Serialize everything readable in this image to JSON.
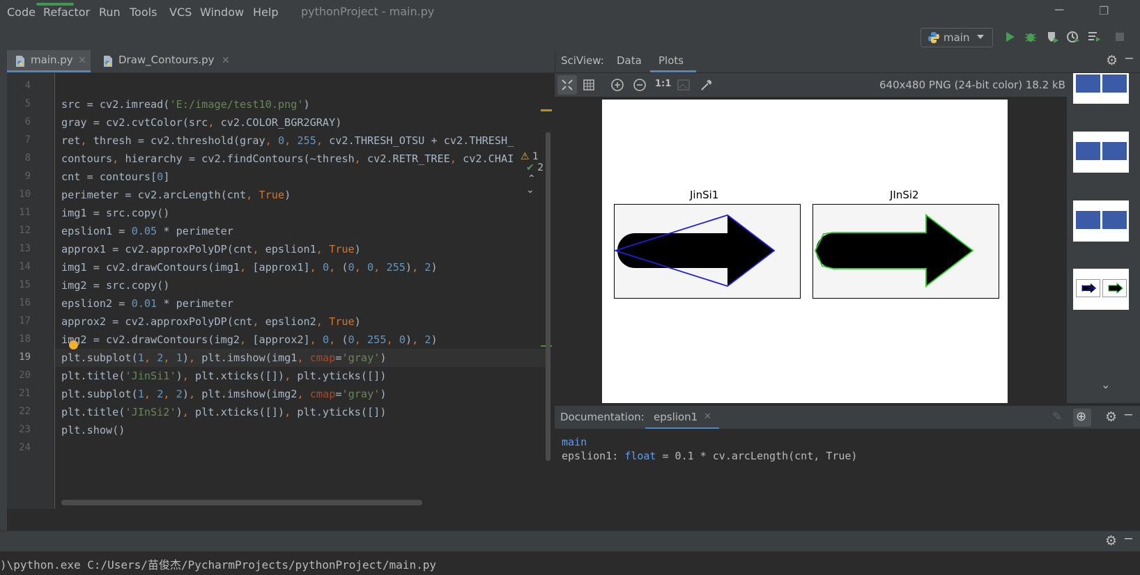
{
  "menu": {
    "items": [
      "Code",
      "Refactor",
      "Run",
      "Tools",
      "VCS",
      "Window",
      "Help"
    ],
    "window_title": "pythonProject - main.py"
  },
  "toolbar": {
    "run_config": "main",
    "icons": [
      "python-icon",
      "run-icon",
      "debug-icon",
      "coverage-icon",
      "profile-icon",
      "run-menu-icon",
      "stop-icon"
    ]
  },
  "editor": {
    "tabs": [
      {
        "label": "main.py",
        "active": true
      },
      {
        "label": "Draw_Contours.py",
        "active": false
      }
    ],
    "inspection": {
      "warnings": "1",
      "weak_warnings": "2"
    },
    "line_numbers": [
      "4",
      "5",
      "6",
      "7",
      "8",
      "9",
      "10",
      "11",
      "12",
      "13",
      "14",
      "15",
      "16",
      "17",
      "18",
      "19",
      "20",
      "21",
      "22",
      "23",
      "24"
    ],
    "current_line": "19"
  },
  "sciview": {
    "title": "SciView:",
    "tabs": [
      "Data",
      "Plots"
    ],
    "active_tab": "Plots",
    "image_info": "640x480 PNG (24-bit color) 18.2 kB",
    "zoom_label": "1:1",
    "plot": {
      "subplot_titles": [
        "JinSi1",
        "JInSi2"
      ],
      "approx_colors": [
        "#1f1fe0",
        "#22cc22"
      ]
    }
  },
  "documentation": {
    "title": "Documentation:",
    "tab": "epslion1",
    "module": "main",
    "signature_name": "epslion1",
    "signature_colon": ":",
    "signature_type": "float",
    "signature_value": " = 0.1 * cv.arcLength(cnt, True)"
  },
  "console": {
    "line": ")\\python.exe C:/Users/苗俊杰/PycharmProjects/pythonProject/main.py"
  },
  "colors": {
    "accent": "#4a88c7",
    "string": "#6a8759",
    "number": "#6897bb",
    "keyword": "#cc7832",
    "param": "#aa4926"
  }
}
